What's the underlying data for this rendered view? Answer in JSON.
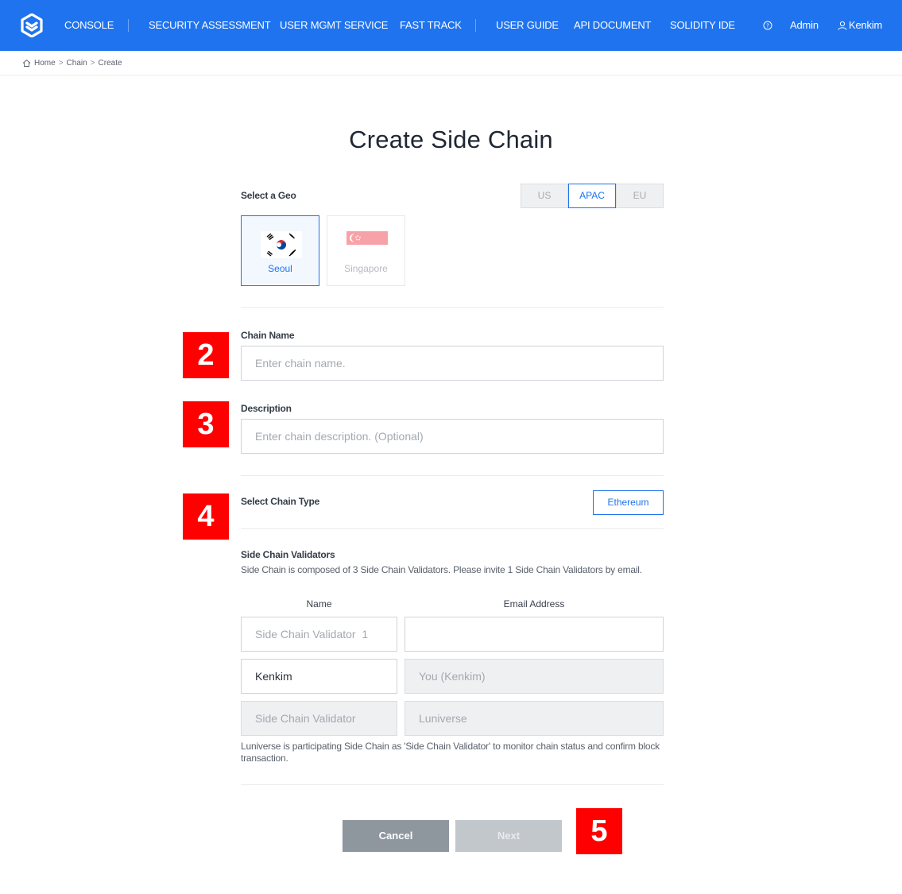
{
  "nav": {
    "items": [
      "CONSOLE",
      "SECURITY ASSESSMENT",
      "USER MGMT SERVICE",
      "FAST TRACK",
      "USER GUIDE",
      "API DOCUMENT",
      "SOLIDITY IDE"
    ],
    "admin": "Admin",
    "user": "Kenkim",
    "brand_color": "#1f73ee"
  },
  "breadcrumb": [
    "Home",
    "Chain",
    "Create"
  ],
  "page_title": "Create Side Chain",
  "geo": {
    "label": "Select a Geo",
    "tabs": [
      "US",
      "APAC",
      "EU"
    ],
    "selected_tab": "APAC",
    "cities": [
      {
        "name": "Seoul",
        "flag": "south-korea-flag",
        "selected": true
      },
      {
        "name": "Singapore",
        "flag": "singapore-flag",
        "selected": false
      }
    ]
  },
  "chain_name": {
    "label": "Chain Name",
    "placeholder": "Enter chain name.",
    "value": ""
  },
  "description": {
    "label": "Description",
    "placeholder": "Enter chain description. (Optional)",
    "value": ""
  },
  "chain_type": {
    "label": "Select Chain Type",
    "option": "Ethereum"
  },
  "validators": {
    "title": "Side Chain Validators",
    "subtitle": "Side Chain is composed of 3 Side Chain Validators. Please invite 1 Side Chain Validators by email.",
    "col_name": "Name",
    "col_email": "Email Address",
    "rows": [
      {
        "name_placeholder": "Side Chain Validator  1",
        "name_value": "",
        "email_value": "",
        "email_placeholder": ""
      },
      {
        "name_value": "Kenkim",
        "email_placeholder": "You (Kenkim)"
      },
      {
        "name_placeholder": "Side Chain Validator",
        "email_placeholder": "Luniverse"
      }
    ],
    "note": "Luniverse is participating Side Chain as 'Side Chain Validator' to monitor chain status and confirm block transaction."
  },
  "actions": {
    "cancel": "Cancel",
    "next": "Next"
  },
  "markers": [
    "2",
    "3",
    "4",
    "5"
  ],
  "marker_color": "#ff0000"
}
